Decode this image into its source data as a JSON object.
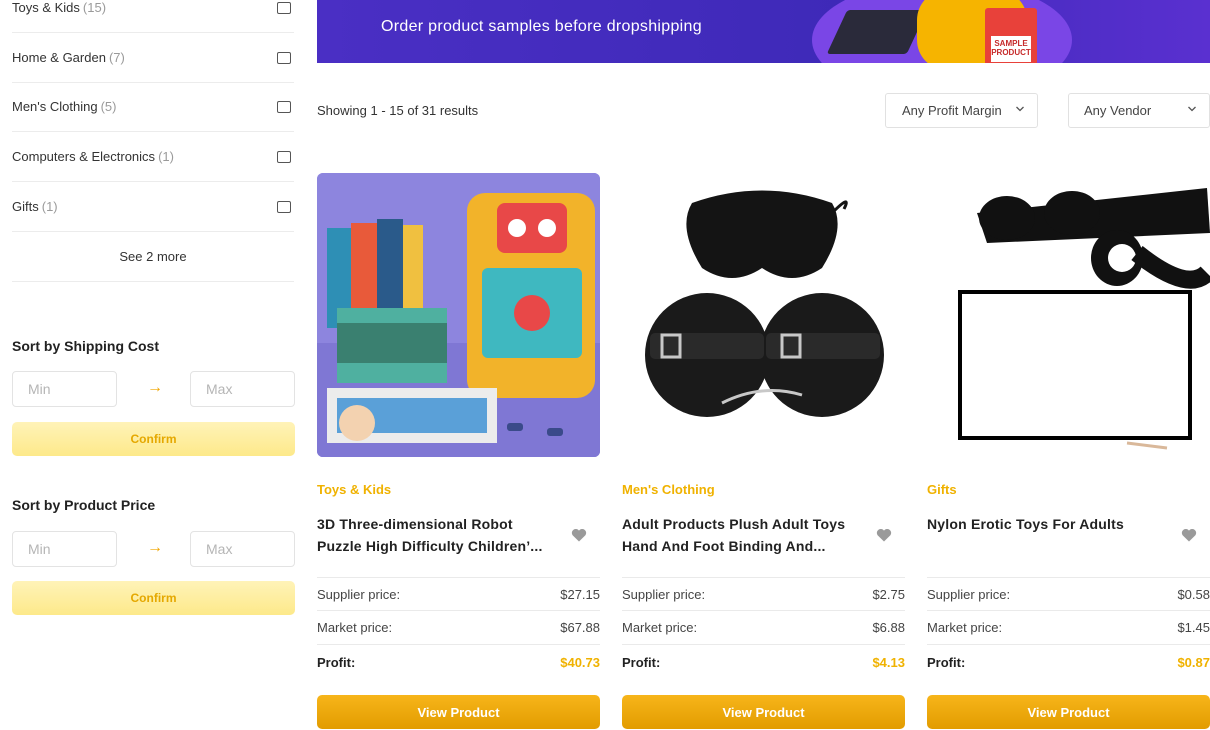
{
  "sidebar": {
    "categories": [
      {
        "label": "Toys & Kids",
        "count": "(15)"
      },
      {
        "label": "Home & Garden",
        "count": "(7)"
      },
      {
        "label": "Men's Clothing",
        "count": "(5)"
      },
      {
        "label": "Computers & Electronics",
        "count": "(1)"
      },
      {
        "label": "Gifts",
        "count": "(1)"
      }
    ],
    "see_more": "See 2 more",
    "shipping": {
      "title": "Sort by Shipping Cost",
      "min_placeholder": "Min",
      "max_placeholder": "Max",
      "arrow": "→",
      "confirm": "Confirm"
    },
    "price": {
      "title": "Sort by Product Price",
      "min_placeholder": "Min",
      "max_placeholder": "Max",
      "arrow": "→",
      "confirm": "Confirm"
    }
  },
  "banner": {
    "subtitle": "Order product samples before dropshipping",
    "sample_label": "SAMPLE PRODUCT"
  },
  "toolbar": {
    "results": "Showing 1 - 15 of 31 results",
    "profit_filter": "Any Profit Margin",
    "vendor_filter": "Any Vendor"
  },
  "products": [
    {
      "category": "Toys & Kids",
      "name": "3D Three-dimensional Robot Puzzle High Difficulty Children’...",
      "supplier_label": "Supplier price:",
      "supplier_price": "$27.15",
      "market_label": "Market price:",
      "market_price": "$67.88",
      "profit_label": "Profit:",
      "profit": "$40.73",
      "button": "View Product",
      "image": "robot-puzzle-image"
    },
    {
      "category": "Men's Clothing",
      "name": "Adult Products Plush Adult Toys Hand And Foot Binding And...",
      "supplier_label": "Supplier price:",
      "supplier_price": "$2.75",
      "market_label": "Market price:",
      "market_price": "$6.88",
      "profit_label": "Profit:",
      "profit": "$4.13",
      "button": "View Product",
      "image": "plush-cuffs-image"
    },
    {
      "category": "Gifts",
      "name": "Nylon Erotic Toys For Adults",
      "supplier_label": "Supplier price:",
      "supplier_price": "$0.58",
      "market_label": "Market price:",
      "market_price": "$1.45",
      "profit_label": "Profit:",
      "profit": "$0.87",
      "button": "View Product",
      "image": "nylon-straps-image"
    }
  ],
  "colors": {
    "accent": "#f0b200",
    "banner": "#4a2fc4",
    "button": "#e9a300",
    "confirm_bg": "#fdeb95"
  }
}
